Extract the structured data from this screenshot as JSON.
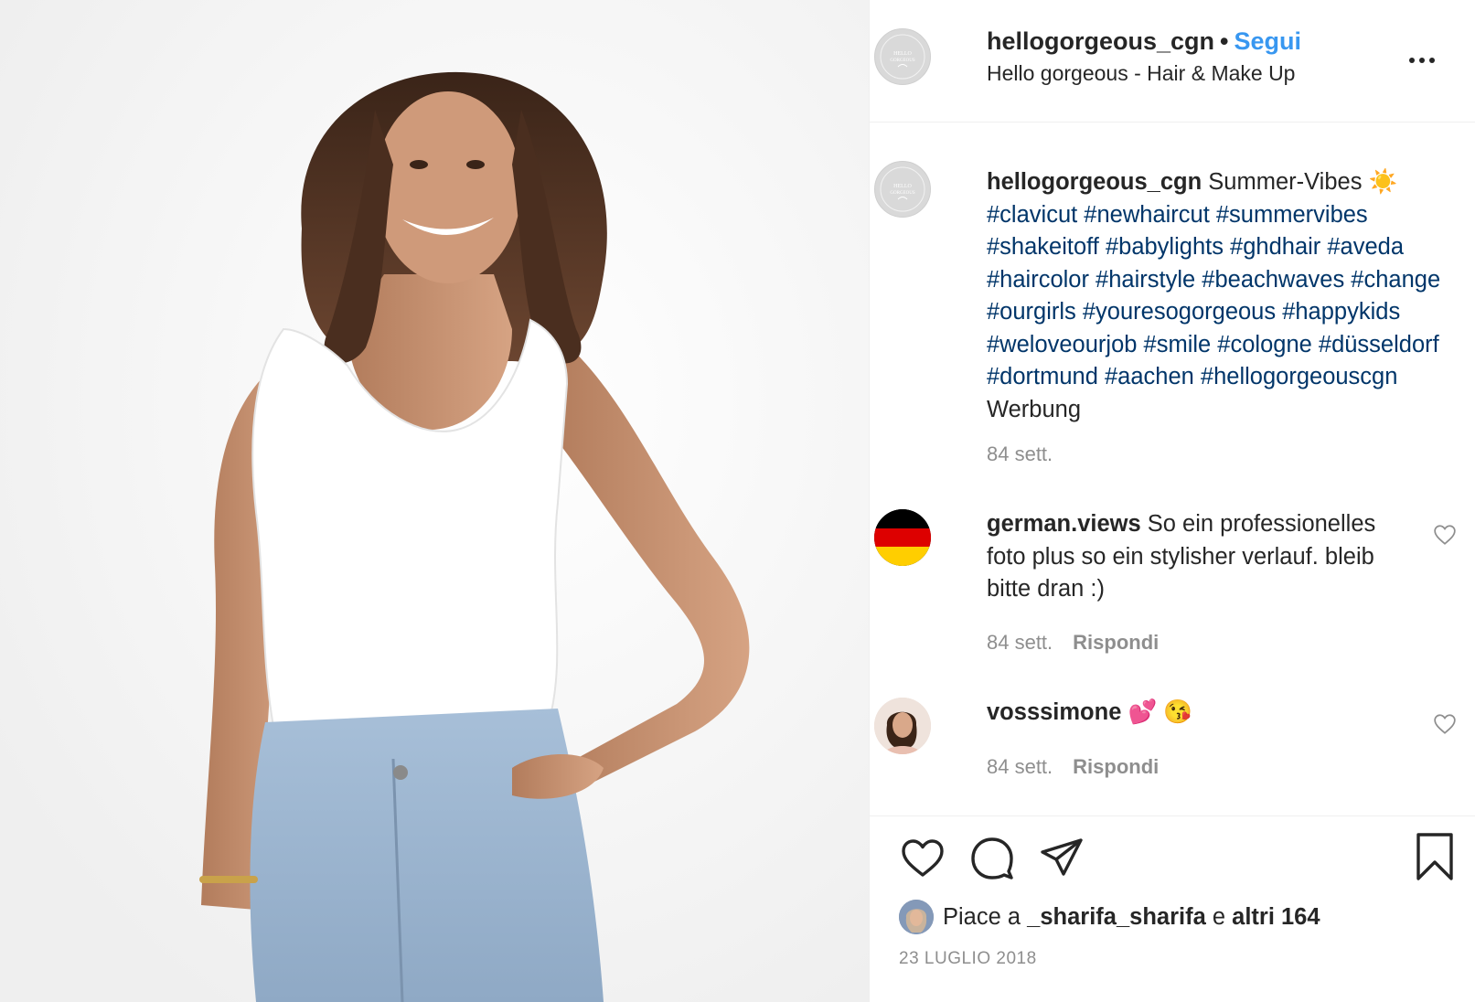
{
  "post": {
    "author": {
      "username": "hellogorgeous_cgn",
      "separator": "•",
      "follow_label": "Segui",
      "subtitle": "Hello gorgeous - Hair & Make Up",
      "avatar_text_top": "HELLO",
      "avatar_text_bottom": "GORGEOUS"
    },
    "caption": {
      "username": "hellogorgeous_cgn",
      "text": "Summer-Vibes ☀️",
      "hashtags": "#clavicut #newhaircut #summervibes #shakeitoff #babylights #ghdhair #aveda #haircolor #hairstyle #beachwaves #change #ourgirls #youresogorgeous #happykids #weloveourjob #smile #cologne #düsseldorf #dortmund #aachen #hellogorgeouscgn",
      "trailing": "Werbung",
      "time": "84 sett."
    },
    "comments": [
      {
        "username": "german.views",
        "text": "So ein professionelles foto plus so ein stylisher verlauf. bleib bitte dran :)",
        "time": "84 sett.",
        "reply_label": "Rispondi"
      },
      {
        "username": "vosssimone",
        "text": "💕 😘",
        "time": "84 sett.",
        "reply_label": "Rispondi"
      }
    ],
    "likes": {
      "prefix": "Piace a",
      "user": "_sharifa_sharifa",
      "connector": "e",
      "others": "altri 164"
    },
    "date": "23 LUGLIO 2018"
  },
  "icons": {
    "more": "more-options-icon",
    "like": "heart-icon",
    "comment": "comment-icon",
    "share": "send-icon",
    "save": "bookmark-icon"
  },
  "colors": {
    "link": "#3897f0",
    "hashtag": "#003569",
    "muted": "#8e8e8e",
    "text": "#262626"
  }
}
